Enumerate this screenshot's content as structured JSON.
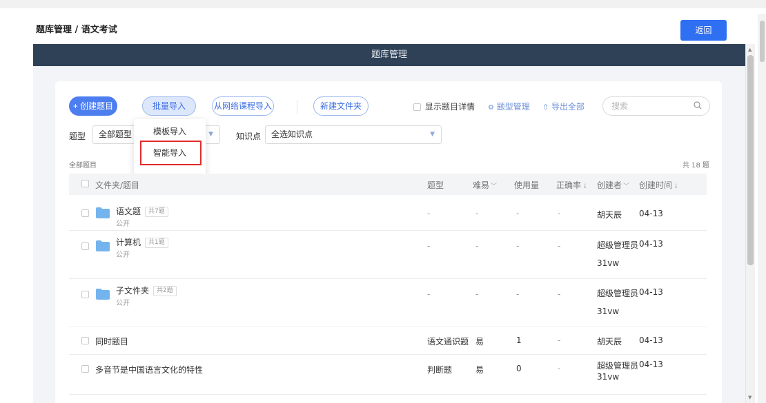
{
  "breadcrumb": "题库管理 / 语文考试",
  "back_button": "返回",
  "panel_title": "题库管理",
  "toolbar": {
    "create": "+ 创建题目",
    "batch_import": "批量导入",
    "network_import": "从网络课程导入",
    "new_folder": "新建文件夹",
    "show_detail": "显示题目详情",
    "type_manage": "题型管理",
    "export_all": "导出全部",
    "search_placeholder": "搜索"
  },
  "filters": {
    "type_label": "题型",
    "type_value": "全部题型",
    "knowledge_label": "知识点",
    "knowledge_value": "全选知识点"
  },
  "dropdown": {
    "items": [
      "模板导入",
      "智能导入"
    ]
  },
  "list": {
    "section_label": "全部题目",
    "total": "共 18 题"
  },
  "table": {
    "headers": {
      "name": "文件夹/题目",
      "type": "题型",
      "difficulty": "难易",
      "usage": "使用量",
      "accuracy": "正确率",
      "creator": "创建者",
      "created": "创建时间"
    },
    "rows": [
      {
        "name": "语文题",
        "tag": "共7题",
        "sub": "公开",
        "type": "-",
        "difficulty": "-",
        "usage": "-",
        "accuracy": "-",
        "creator": "胡天辰",
        "creator2": "",
        "created": "04-13"
      },
      {
        "name": "计算机",
        "tag": "共1题",
        "sub": "公开",
        "type": "-",
        "difficulty": "-",
        "usage": "-",
        "accuracy": "-",
        "creator": "超级管理员",
        "creator2": "31vw",
        "created": "04-13"
      },
      {
        "name": "子文件夹",
        "tag": "共2题",
        "sub": "公开",
        "type": "-",
        "difficulty": "-",
        "usage": "-",
        "accuracy": "-",
        "creator": "超级管理员",
        "creator2": "31vw",
        "created": "04-13"
      },
      {
        "name": "同时题目",
        "type": "语文通识题",
        "difficulty": "易",
        "usage": "1",
        "accuracy": "-",
        "creator": "胡天辰",
        "creator2": "",
        "created": "04-13"
      },
      {
        "name": "多音节是中国语言文化的特性",
        "type": "判断题",
        "difficulty": "易",
        "usage": "0",
        "accuracy": "-",
        "creator": "超级管理员",
        "creator2": "31vw",
        "created": "04-13"
      }
    ]
  }
}
